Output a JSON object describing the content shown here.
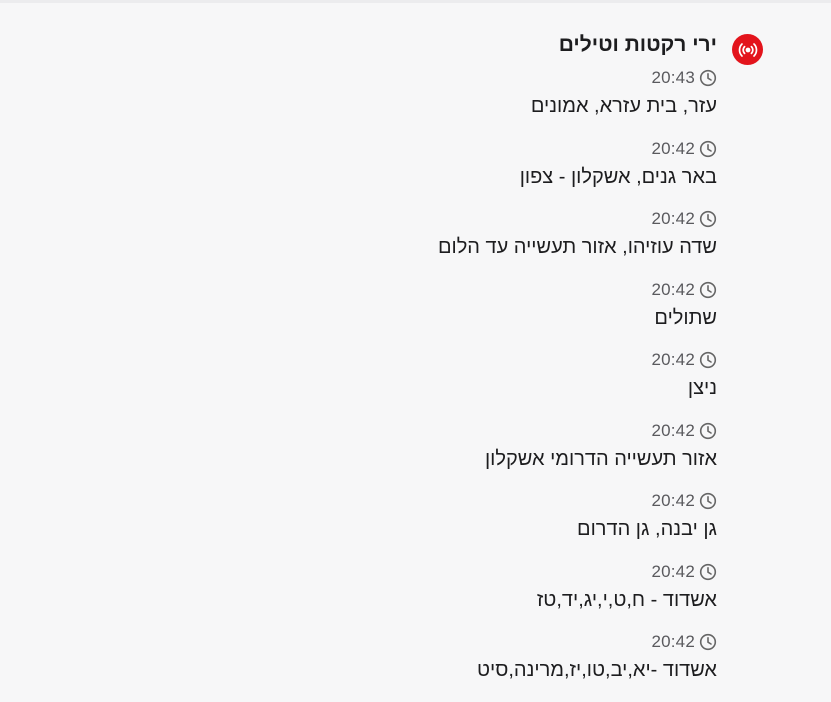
{
  "alert": {
    "title": "ירי רקטות וטילים",
    "badge_icon": "alert-broadcast-icon",
    "badge_color": "#e3141c"
  },
  "entries": [
    {
      "time": "20:43",
      "location": "עזר, בית עזרא, אמונים"
    },
    {
      "time": "20:42",
      "location": "באר גנים, אשקלון - צפון"
    },
    {
      "time": "20:42",
      "location": "שדה עוזיהו, אזור תעשייה עד הלום"
    },
    {
      "time": "20:42",
      "location": "שתולים"
    },
    {
      "time": "20:42",
      "location": "ניצן"
    },
    {
      "time": "20:42",
      "location": "אזור תעשייה הדרומי אשקלון"
    },
    {
      "time": "20:42",
      "location": "גן יבנה, גן הדרום"
    },
    {
      "time": "20:42",
      "location": "אשדוד - ח,ט,י,יג,יד,טז"
    },
    {
      "time": "20:42",
      "location": "אשדוד -יא,יב,טו,יז,מרינה,סיט"
    }
  ]
}
